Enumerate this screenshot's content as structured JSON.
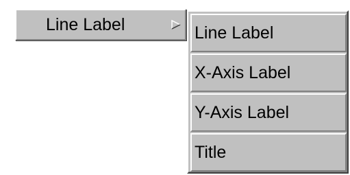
{
  "menu_button": {
    "label": "Line Label",
    "arrow_icon": "cascade-arrow-icon"
  },
  "submenu": {
    "items": [
      {
        "label": "Line Label"
      },
      {
        "label": "X-Axis Label"
      },
      {
        "label": "Y-Axis Label"
      },
      {
        "label": "Title"
      }
    ]
  },
  "colors": {
    "face": "#c0c0c0",
    "highlight": "#ffffff",
    "shadow": "#808080",
    "dark_shadow": "#404040",
    "text": "#000000"
  }
}
